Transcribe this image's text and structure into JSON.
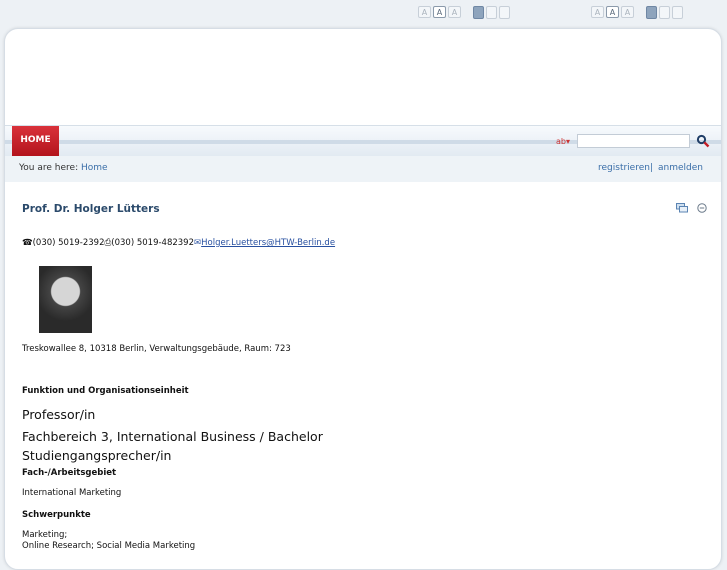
{
  "font_controls": {
    "left": {
      "sizes": [
        "A",
        "A",
        "A"
      ],
      "active_size": 1
    },
    "right": {
      "sizes": [
        "A",
        "A",
        "A"
      ],
      "active_size": 1
    }
  },
  "nav": {
    "home_label": "HOME",
    "lang_label": "ab▾"
  },
  "breadcrumb": {
    "prefix": "You are here:",
    "home": "Home",
    "register": "registrieren",
    "separator": "|",
    "login": "anmelden"
  },
  "person": {
    "title": "Prof. Dr. Holger Lütters",
    "phone": "(030) 5019-2392",
    "fax": "(030) 5019-482392",
    "email": "Holger.Luetters@HTW-Berlin.de",
    "address": "Treskowallee 8, 10318 Berlin, Verwaltungsgebäude, Raum: 723"
  },
  "sections": {
    "function_heading": "Funktion und Organisationseinheit",
    "role": "Professor/in",
    "department": "Fachbereich 3, International Business / Bachelor",
    "program_lead": "Studiengangsprecher/in",
    "field_heading": "Fach-/Arbeitsgebiet",
    "field": "International Marketing",
    "focus_heading": "Schwerpunkte",
    "focus1": "Marketing;",
    "focus2": "Online Research; Social Media Marketing"
  },
  "colors": {
    "accent_red": "#c41e26",
    "link_blue": "#3a6ea8",
    "title_blue": "#2b4a6b"
  }
}
